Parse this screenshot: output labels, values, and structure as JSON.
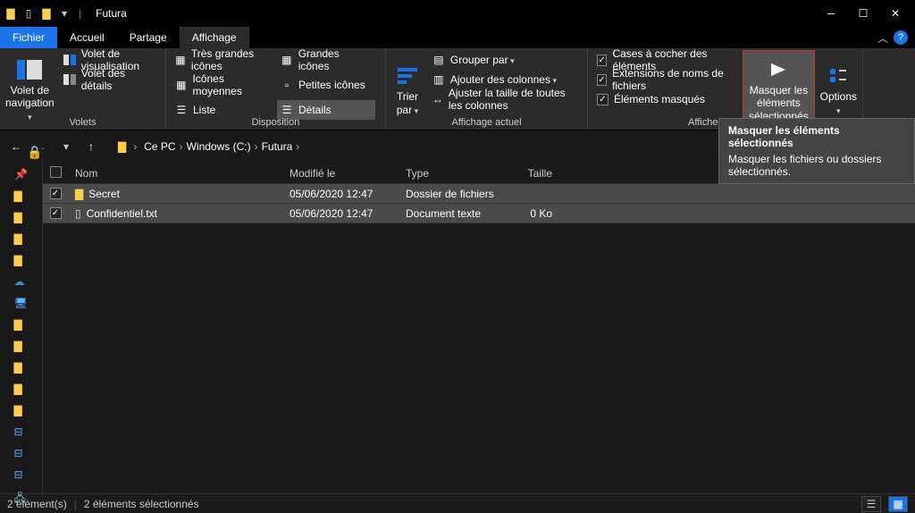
{
  "titlebar": {
    "title": "Futura"
  },
  "tabs": {
    "file": "Fichier",
    "home": "Accueil",
    "share": "Partage",
    "view": "Affichage"
  },
  "ribbon": {
    "panes_group": "Volets",
    "nav_pane": "Volet de navigation",
    "preview_pane": "Volet de visualisation",
    "details_pane": "Volet des détails",
    "layout_group": "Disposition",
    "extra_large": "Très grandes icônes",
    "large": "Grandes icônes",
    "medium": "Icônes moyennes",
    "small": "Petites icônes",
    "list": "Liste",
    "details": "Détails",
    "current_view_group": "Affichage actuel",
    "sort_by": "Trier par",
    "group_by": "Grouper par",
    "add_columns": "Ajouter des colonnes",
    "size_all": "Ajuster la taille de toutes les colonnes",
    "show_hide_group": "Afficher/Masquer",
    "item_checkboxes": "Cases à cocher des éléments",
    "file_ext": "Extensions de noms de fichiers",
    "hidden_items": "Éléments masqués",
    "hide_selected": "Masquer les éléments sélectionnés",
    "options": "Options"
  },
  "breadcrumbs": {
    "b0": "Ce PC",
    "b1": "Windows (C:)",
    "b2": "Futura"
  },
  "columns": {
    "name": "Nom",
    "modified": "Modifié le",
    "type": "Type",
    "size": "Taille"
  },
  "rows": [
    {
      "name": "Secret",
      "modified": "05/06/2020 12:47",
      "type": "Dossier de fichiers",
      "size": "",
      "kind": "folder"
    },
    {
      "name": "Confidentiel.txt",
      "modified": "05/06/2020 12:47",
      "type": "Document texte",
      "size": "0 Ko",
      "kind": "file"
    }
  ],
  "status": {
    "count": "2 élément(s)",
    "selected": "2 éléments sélectionnés"
  },
  "tooltip": {
    "title": "Masquer les éléments sélectionnés",
    "body": "Masquer les fichiers ou dossiers sélectionnés."
  }
}
